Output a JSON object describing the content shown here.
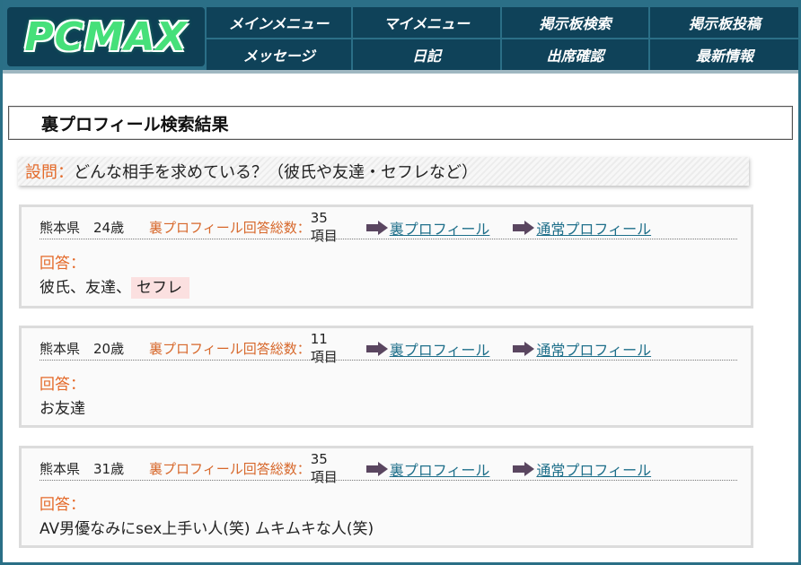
{
  "header": {
    "logo_text": "PCMAX",
    "logo_color": "#46e07a",
    "nav": [
      {
        "label": "メインメニュー"
      },
      {
        "label": "マイメニュー"
      },
      {
        "label": "掲示板検索"
      },
      {
        "label": "掲示板投稿"
      },
      {
        "label": "メッセージ"
      },
      {
        "label": "日記"
      },
      {
        "label": "出席確認"
      },
      {
        "label": "最新情報"
      }
    ]
  },
  "page_title": "裏プロフィール検索結果",
  "question": {
    "label": "設問：",
    "text": "どんな相手を求めている？（彼氏や友達・セフレなど）"
  },
  "results": [
    {
      "prefecture": "熊本県",
      "age": "24歳",
      "count_label": "裏プロフィール回答総数：",
      "count_value": "35項目",
      "link_ura": "裏プロフィール",
      "link_normal": "通常プロフィール",
      "answer_label": "回答：",
      "answer_text": "彼氏、友達、",
      "answer_highlight": "セフレ"
    },
    {
      "prefecture": "熊本県",
      "age": "20歳",
      "count_label": "裏プロフィール回答総数：",
      "count_value": "11項目",
      "link_ura": "裏プロフィール",
      "link_normal": "通常プロフィール",
      "answer_label": "回答：",
      "answer_text": "お友達",
      "answer_highlight": ""
    },
    {
      "prefecture": "熊本県",
      "age": "31歳",
      "count_label": "裏プロフィール回答総数：",
      "count_value": "35項目",
      "link_ura": "裏プロフィール",
      "link_normal": "通常プロフィール",
      "answer_label": "回答：",
      "answer_text": "AV男優なみにsex上手い人(笑) ムキムキな人(笑)",
      "answer_highlight": ""
    }
  ],
  "colors": {
    "accent_orange": "#e46a2a",
    "link_blue": "#1e6f8a",
    "header_bg": "#2b6f87",
    "nav_bg": "#0f4259",
    "highlight": "#fbe0e0"
  }
}
